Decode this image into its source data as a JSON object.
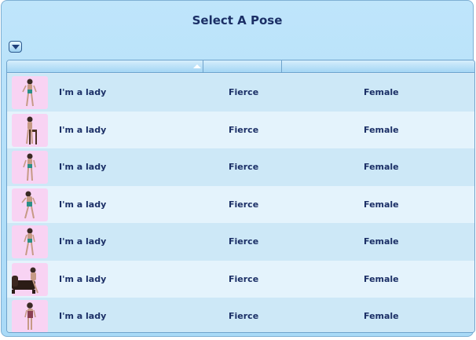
{
  "dialog": {
    "title": "Select A Pose",
    "accent_color": "#a9daf7",
    "text_color": "#1b2f66"
  },
  "list": {
    "sort_indicator": "sort-ascending-icon",
    "rows": [
      {
        "name": "I'm a lady",
        "style": "Fierce",
        "gender": "Female",
        "thumb_icon": "standing-pose-icon"
      },
      {
        "name": "I'm a lady",
        "style": "Fierce",
        "gender": "Female",
        "thumb_icon": "chair-pose-icon"
      },
      {
        "name": "I'm a lady",
        "style": "Fierce",
        "gender": "Female",
        "thumb_icon": "standing-pose-icon"
      },
      {
        "name": "I'm a lady",
        "style": "Fierce",
        "gender": "Female",
        "thumb_icon": "standing-pose-icon"
      },
      {
        "name": "I'm a lady",
        "style": "Fierce",
        "gender": "Female",
        "thumb_icon": "standing-pose-icon"
      },
      {
        "name": "I'm a lady",
        "style": "Fierce",
        "gender": "Female",
        "thumb_icon": "sofa-pose-icon"
      },
      {
        "name": "I'm a lady",
        "style": "Fierce",
        "gender": "Female",
        "thumb_icon": "standing-pose-icon"
      }
    ]
  }
}
